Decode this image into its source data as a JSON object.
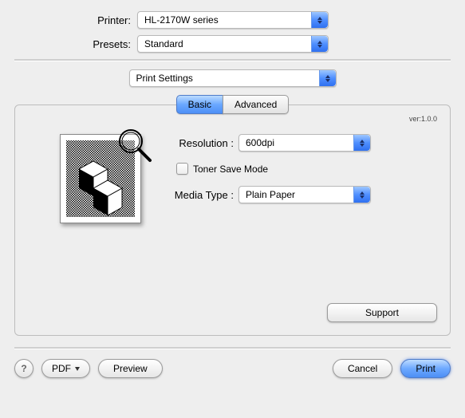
{
  "labels": {
    "printer": "Printer:",
    "presets": "Presets:"
  },
  "printer": {
    "value": "HL-2170W series"
  },
  "presets": {
    "value": "Standard"
  },
  "settings_dropdown": "Print Settings",
  "tabs": {
    "basic": "Basic",
    "advanced": "Advanced"
  },
  "version": "ver:1.0.0",
  "resolution": {
    "label": "Resolution :",
    "value": "600dpi"
  },
  "toner_save": {
    "label": "Toner Save Mode"
  },
  "media_type": {
    "label": "Media Type :",
    "value": "Plain Paper"
  },
  "buttons": {
    "support": "Support",
    "help": "?",
    "pdf": "PDF",
    "preview": "Preview",
    "cancel": "Cancel",
    "print": "Print"
  }
}
